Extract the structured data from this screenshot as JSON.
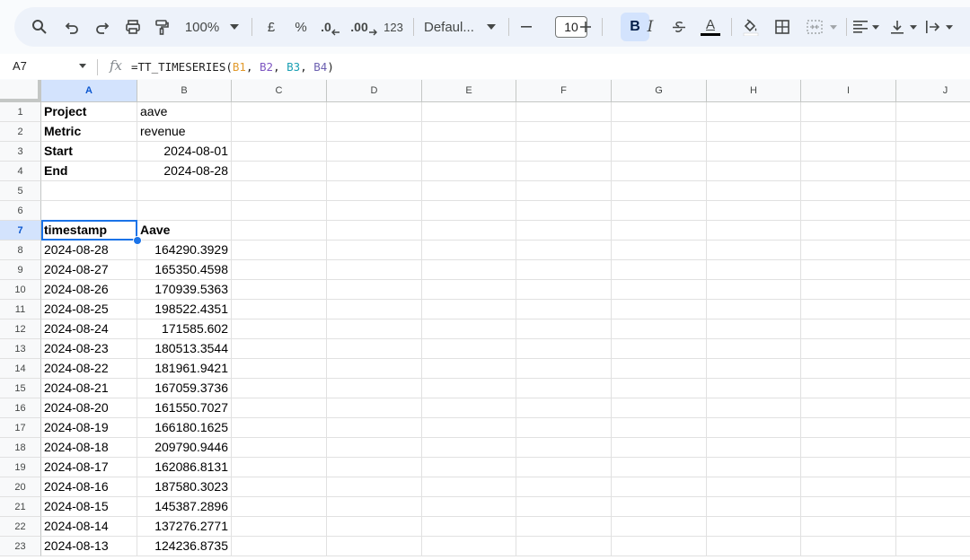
{
  "toolbar": {
    "zoom": "100%",
    "currency": "£",
    "percent": "%",
    "decimal_decrease": ".0",
    "decimal_increase": ".00",
    "number_format": "123",
    "font_name": "Defaul...",
    "font_size": "10",
    "bold": "B",
    "italic": "I",
    "text_color": "A"
  },
  "formula_bar": {
    "name_box": "A7",
    "fx": "fx",
    "formula_prefix": "=TT_TIMESERIES(",
    "ref1": "B1",
    "ref2": "B2",
    "ref3": "B3",
    "ref4": "B4",
    "comma": ", ",
    "formula_suffix": ")"
  },
  "columns": [
    "A",
    "B",
    "C",
    "D",
    "E",
    "F",
    "G",
    "H",
    "I",
    "J"
  ],
  "rows": [
    {
      "n": "1",
      "a": "Project",
      "b": "aave",
      "a_bold": true,
      "b_num": false
    },
    {
      "n": "2",
      "a": "Metric",
      "b": "revenue",
      "a_bold": true,
      "b_num": false
    },
    {
      "n": "3",
      "a": "Start",
      "b": "2024-08-01",
      "a_bold": true,
      "b_num": true
    },
    {
      "n": "4",
      "a": "End",
      "b": "2024-08-28",
      "a_bold": true,
      "b_num": true
    },
    {
      "n": "5",
      "a": "",
      "b": ""
    },
    {
      "n": "6",
      "a": "",
      "b": ""
    },
    {
      "n": "7",
      "a": "timestamp",
      "b": "Aave",
      "a_bold": true,
      "b_bold": true
    },
    {
      "n": "8",
      "a": "2024-08-28",
      "b": "164290.3929",
      "b_num": true
    },
    {
      "n": "9",
      "a": "2024-08-27",
      "b": "165350.4598",
      "b_num": true
    },
    {
      "n": "10",
      "a": "2024-08-26",
      "b": "170939.5363",
      "b_num": true
    },
    {
      "n": "11",
      "a": "2024-08-25",
      "b": "198522.4351",
      "b_num": true
    },
    {
      "n": "12",
      "a": "2024-08-24",
      "b": "171585.602",
      "b_num": true
    },
    {
      "n": "13",
      "a": "2024-08-23",
      "b": "180513.3544",
      "b_num": true
    },
    {
      "n": "14",
      "a": "2024-08-22",
      "b": "181961.9421",
      "b_num": true
    },
    {
      "n": "15",
      "a": "2024-08-21",
      "b": "167059.3736",
      "b_num": true
    },
    {
      "n": "16",
      "a": "2024-08-20",
      "b": "161550.7027",
      "b_num": true
    },
    {
      "n": "17",
      "a": "2024-08-19",
      "b": "166180.1625",
      "b_num": true
    },
    {
      "n": "18",
      "a": "2024-08-18",
      "b": "209790.9446",
      "b_num": true
    },
    {
      "n": "19",
      "a": "2024-08-17",
      "b": "162086.8131",
      "b_num": true
    },
    {
      "n": "20",
      "a": "2024-08-16",
      "b": "187580.3023",
      "b_num": true
    },
    {
      "n": "21",
      "a": "2024-08-15",
      "b": "145387.2896",
      "b_num": true
    },
    {
      "n": "22",
      "a": "2024-08-14",
      "b": "137276.2771",
      "b_num": true
    },
    {
      "n": "23",
      "a": "2024-08-13",
      "b": "124236.8735",
      "b_num": true
    }
  ],
  "selection": {
    "row": "7",
    "col": "A"
  }
}
